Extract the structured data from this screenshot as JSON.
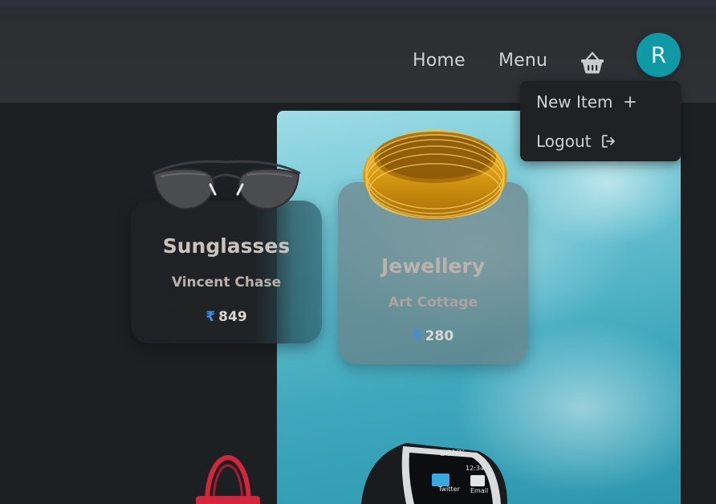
{
  "nav": {
    "home_label": "Home",
    "menu_label": "Menu",
    "cart_icon": "basket-icon",
    "avatar_initial": "R"
  },
  "dropdown": {
    "new_item_label": "New Item",
    "new_item_icon": "plus-icon",
    "logout_label": "Logout",
    "logout_icon": "logout-icon"
  },
  "products": [
    {
      "title": "Sunglasses",
      "brand": "Vincent Chase",
      "currency": "₹",
      "price": "849"
    },
    {
      "title": "Jewellery",
      "brand": "Art Cottage",
      "currency": "₹",
      "price": "280"
    }
  ],
  "colors": {
    "accent": "#0f98a6",
    "rupee": "#3c8fe6",
    "background": "#1d2022"
  }
}
